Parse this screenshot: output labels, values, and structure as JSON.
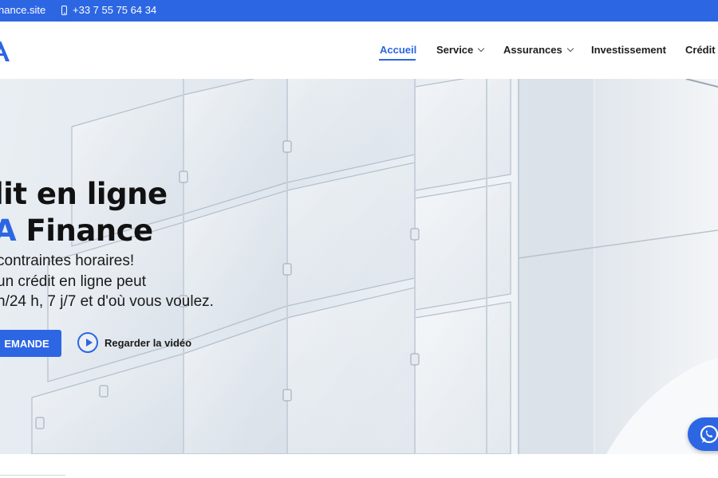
{
  "topbar": {
    "email": "nance.site",
    "phone": "+33 7 55 75 64 34"
  },
  "nav": {
    "items": [
      {
        "label": "Accueil",
        "active": true
      },
      {
        "label": "Service",
        "dropdown": true
      },
      {
        "label": "Assurances",
        "dropdown": true
      },
      {
        "label": "Investissement"
      },
      {
        "label": "Crédit"
      }
    ]
  },
  "hero": {
    "title_line1": "lit en ligne",
    "title_line2_accent": "A",
    "title_line2_rest": " Finance",
    "sub_line1": "contraintes horaires!",
    "sub_line2": "un crédit en ligne peut",
    "sub_line3": "h/24 h, 7 j/7 et d'où vous voulez.",
    "cta_label": "EMANDE",
    "video_label": "Regarder la vidéo"
  },
  "colors": {
    "accent": "#2c66e3",
    "topbar": "#2c66e3",
    "text": "#111111"
  },
  "icons": {
    "phone": "phone-icon",
    "play": "play-icon",
    "whatsapp": "whatsapp-icon",
    "chevron": "chevron-down-icon"
  }
}
